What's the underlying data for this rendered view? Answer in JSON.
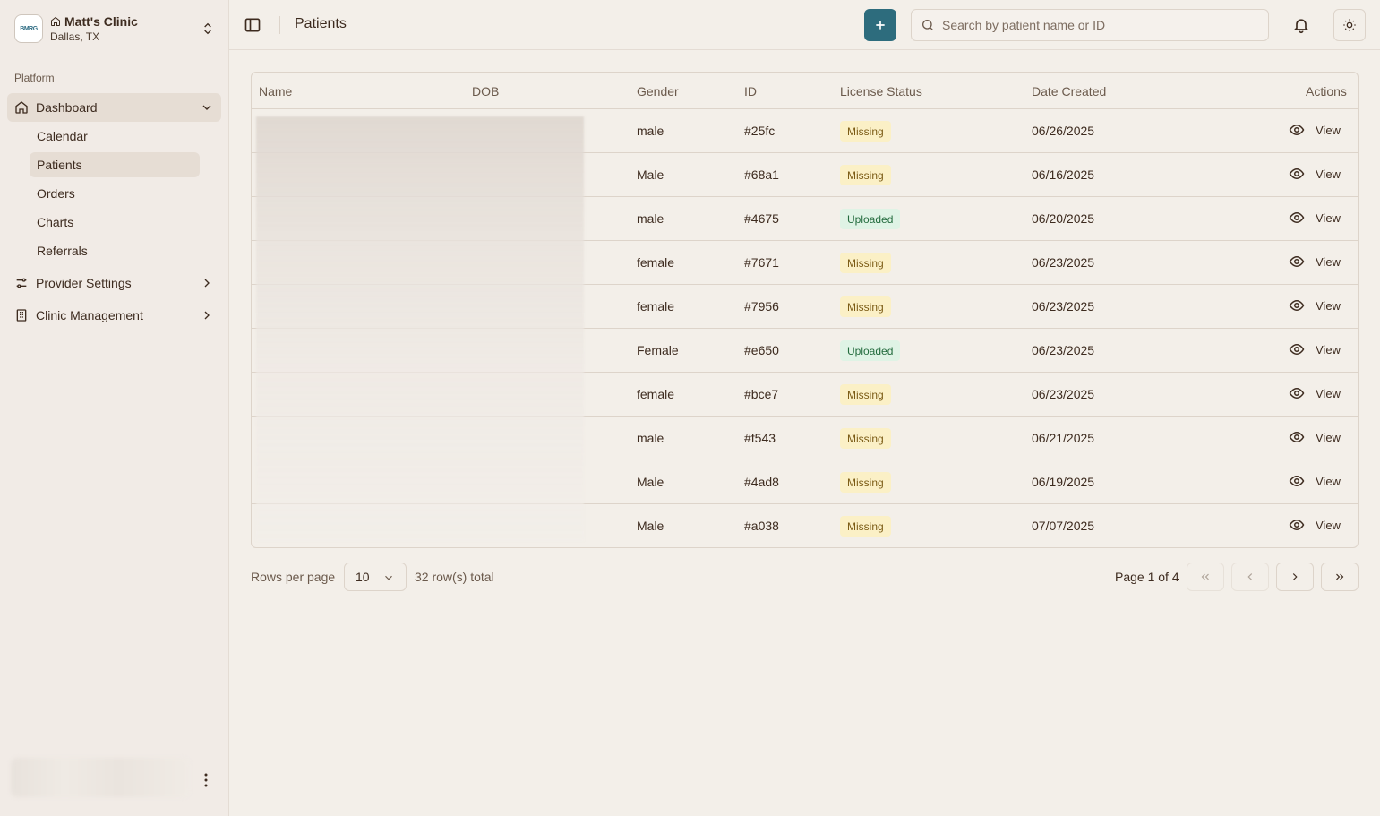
{
  "clinic": {
    "name": "Matt's Clinic",
    "location": "Dallas, TX",
    "logo_text": "BMRG"
  },
  "sidebar": {
    "section_label": "Platform",
    "dashboard_label": "Dashboard",
    "sub_items": [
      "Calendar",
      "Patients",
      "Orders",
      "Charts",
      "Referrals"
    ],
    "provider_settings_label": "Provider Settings",
    "clinic_management_label": "Clinic Management"
  },
  "header": {
    "title": "Patients",
    "search_placeholder": "Search by patient name or ID"
  },
  "table": {
    "columns": [
      "Name",
      "DOB",
      "Gender",
      "ID",
      "License Status",
      "Date Created",
      "Actions"
    ],
    "view_label": "View",
    "rows": [
      {
        "gender": "male",
        "id": "#25fc",
        "status": "Missing",
        "date": "06/26/2025"
      },
      {
        "gender": "Male",
        "id": "#68a1",
        "status": "Missing",
        "date": "06/16/2025"
      },
      {
        "gender": "male",
        "id": "#4675",
        "status": "Uploaded",
        "date": "06/20/2025"
      },
      {
        "gender": "female",
        "id": "#7671",
        "status": "Missing",
        "date": "06/23/2025"
      },
      {
        "gender": "female",
        "id": "#7956",
        "status": "Missing",
        "date": "06/23/2025"
      },
      {
        "gender": "Female",
        "id": "#e650",
        "status": "Uploaded",
        "date": "06/23/2025"
      },
      {
        "gender": "female",
        "id": "#bce7",
        "status": "Missing",
        "date": "06/23/2025"
      },
      {
        "gender": "male",
        "id": "#f543",
        "status": "Missing",
        "date": "06/21/2025"
      },
      {
        "gender": "Male",
        "id": "#4ad8",
        "status": "Missing",
        "date": "06/19/2025"
      },
      {
        "gender": "Male",
        "id": "#a038",
        "status": "Missing",
        "date": "07/07/2025"
      }
    ]
  },
  "pagination": {
    "rows_per_page_label": "Rows per page",
    "rows_per_page_value": "10",
    "total_label": "32 row(s) total",
    "page_label": "Page 1 of 4"
  },
  "colors": {
    "accent": "#2d6c7d",
    "missing_bg": "#fbf0c6",
    "uploaded_bg": "#dff3e5"
  }
}
